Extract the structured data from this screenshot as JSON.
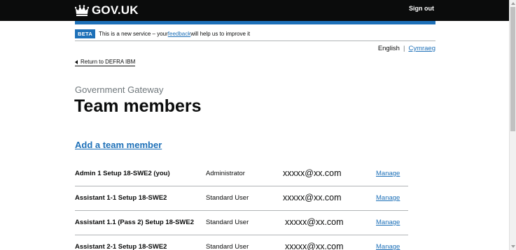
{
  "header": {
    "logo_text": "GOV.UK",
    "sign_out": "Sign out",
    "colors": {
      "background": "#0b0c0c",
      "accent_bar": "#1d70b8"
    }
  },
  "phase_banner": {
    "tag": "BETA",
    "text_before": "This is a new service – your ",
    "link": "feedback",
    "text_after": " will help us to improve it"
  },
  "language": {
    "english": "English",
    "separator": "|",
    "welsh": "Cymraeg"
  },
  "back_link": "Return to DEFRA IBM",
  "caption": "Government Gateway",
  "title": "Team members",
  "add_link": "Add a team member",
  "members": [
    {
      "name": "Admin 1 Setup 18-SWE2 (you)",
      "role": "Administrator",
      "email": "xxxxx@xx.com",
      "action": "Manage"
    },
    {
      "name": "Assistant 1-1 Setup 18-SWE2",
      "role": "Standard User",
      "email": "xxxxx@xx.com",
      "action": "Manage"
    },
    {
      "name": "Assistant 1.1 (Pass 2) Setup 18-SWE2",
      "role": "Standard User",
      "email": "xxxxx@xx.com",
      "action": "Manage"
    },
    {
      "name": "Assistant 2-1 Setup 18-SWE2",
      "role": "Standard User",
      "email": "xxxxx@xx.com",
      "action": "Manage"
    }
  ],
  "icons": {
    "logo": "crown-icon",
    "back": "back-arrow-icon",
    "scroll_up": "scroll-up-icon",
    "scroll_down": "scroll-down-icon"
  },
  "link_color": "#1d70b8"
}
